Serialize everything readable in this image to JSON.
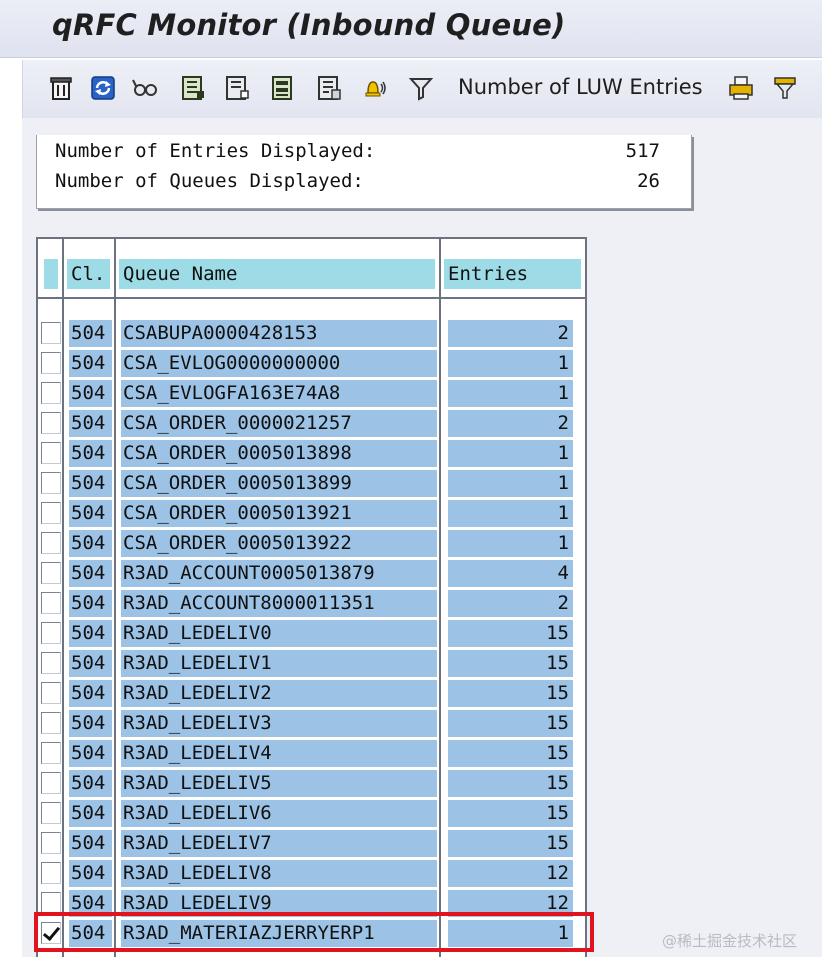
{
  "window": {
    "title": "qRFC Monitor (Inbound Queue)"
  },
  "toolbar": {
    "luw_entries_label": "Number of LUW Entries",
    "icons": [
      "delete-icon",
      "refresh-icon",
      "glasses-icon",
      "select-all-icon",
      "deselect-all-icon",
      "select-block-icon",
      "details-icon",
      "alarm-bell-icon",
      "filter-icon",
      "printer-icon",
      "export-icon"
    ]
  },
  "summary": {
    "entries_label": "Number of Entries Displayed:",
    "entries_value": "517",
    "queues_label": "Number of Queues Displayed:",
    "queues_value": "26"
  },
  "table": {
    "headers": {
      "client": "Cl.",
      "queue": "Queue Name",
      "entries": "Entries"
    },
    "rows": [
      {
        "client": "504",
        "queue": "CSABUPA0000428153",
        "entries": "2",
        "selected": false
      },
      {
        "client": "504",
        "queue": "CSA_EVLOG0000000000",
        "entries": "1",
        "selected": false
      },
      {
        "client": "504",
        "queue": "CSA_EVLOGFA163E74A8",
        "entries": "1",
        "selected": false
      },
      {
        "client": "504",
        "queue": "CSA_ORDER_0000021257",
        "entries": "2",
        "selected": false
      },
      {
        "client": "504",
        "queue": "CSA_ORDER_0005013898",
        "entries": "1",
        "selected": false
      },
      {
        "client": "504",
        "queue": "CSA_ORDER_0005013899",
        "entries": "1",
        "selected": false
      },
      {
        "client": "504",
        "queue": "CSA_ORDER_0005013921",
        "entries": "1",
        "selected": false
      },
      {
        "client": "504",
        "queue": "CSA_ORDER_0005013922",
        "entries": "1",
        "selected": false
      },
      {
        "client": "504",
        "queue": "R3AD_ACCOUNT0005013879",
        "entries": "4",
        "selected": false
      },
      {
        "client": "504",
        "queue": "R3AD_ACCOUNT8000011351",
        "entries": "2",
        "selected": false
      },
      {
        "client": "504",
        "queue": "R3AD_LEDELIV0",
        "entries": "15",
        "selected": false
      },
      {
        "client": "504",
        "queue": "R3AD_LEDELIV1",
        "entries": "15",
        "selected": false
      },
      {
        "client": "504",
        "queue": "R3AD_LEDELIV2",
        "entries": "15",
        "selected": false
      },
      {
        "client": "504",
        "queue": "R3AD_LEDELIV3",
        "entries": "15",
        "selected": false
      },
      {
        "client": "504",
        "queue": "R3AD_LEDELIV4",
        "entries": "15",
        "selected": false
      },
      {
        "client": "504",
        "queue": "R3AD_LEDELIV5",
        "entries": "15",
        "selected": false
      },
      {
        "client": "504",
        "queue": "R3AD_LEDELIV6",
        "entries": "15",
        "selected": false
      },
      {
        "client": "504",
        "queue": "R3AD_LEDELIV7",
        "entries": "15",
        "selected": false
      },
      {
        "client": "504",
        "queue": "R3AD_LEDELIV8",
        "entries": "12",
        "selected": false
      },
      {
        "client": "504",
        "queue": "R3AD_LEDELIV9",
        "entries": "12",
        "selected": false
      },
      {
        "client": "504",
        "queue": "R3AD_MATERIAZJERRYERP1",
        "entries": "1",
        "selected": true
      }
    ]
  },
  "watermark": "@稀土掘金技术社区"
}
